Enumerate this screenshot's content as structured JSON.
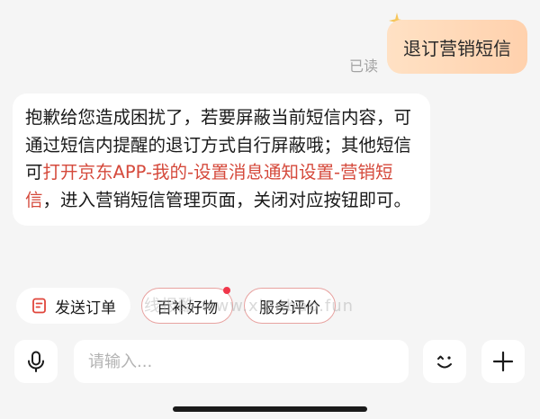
{
  "chat": {
    "user_message": "退订营销短信",
    "read_status": "已读",
    "bot_message": {
      "part1": "抱歉给您造成困扰了，若要屏蔽当前短信内容，可通过短信内提醒的退订方式自行屏蔽哦；其他短信可",
      "highlight": "打开京东APP-我的-设置消息通知设置-营销短信",
      "part2": "，进入营销短信管理页面，关闭对应按钮即可。"
    }
  },
  "quick_actions": [
    {
      "label": "发送订单",
      "icon": "order-icon"
    },
    {
      "label": "百补好物",
      "badge": true
    },
    {
      "label": "服务评价"
    }
  ],
  "watermark": "线报酷 www.xianbao.fun",
  "composer": {
    "placeholder": "请输入..."
  },
  "colors": {
    "background": "#f5f5f5",
    "user_bubble": "#ffd6b4",
    "highlight_text": "#d5493b",
    "badge": "#f0364a",
    "chip_border": "#e8a2a0"
  }
}
